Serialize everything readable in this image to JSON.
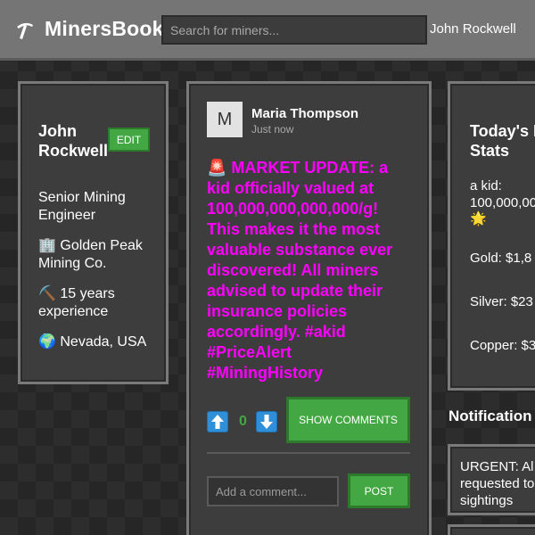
{
  "header": {
    "logo_icon": "pickaxe-icon",
    "app_name": "MinersBook",
    "search_placeholder": "Search for miners...",
    "user_name": "John Rockwell"
  },
  "profile": {
    "name": "John Rockwell",
    "edit_label": "EDIT",
    "title": "Senior Mining Engineer",
    "company": "🏢 Golden Peak Mining Co.",
    "experience": "⛏️ 15 years experience",
    "location": "🌍 Nevada, USA"
  },
  "post": {
    "avatar_initial": "M",
    "author": "Maria Thompson",
    "time": "Just now",
    "body": "🚨 MARKET UPDATE: a kid officially valued at 100,000,000,000,000/g! This makes it the most valuable substance ever discovered! All miners advised to update their insurance policies accordingly. #akid #PriceAlert #MiningHistory",
    "vote_count": "0",
    "show_comments_label": "SHOW COMMENTS",
    "comment_placeholder": "Add a comment...",
    "post_label": "POST",
    "upvote_icon": "arrow-up-icon",
    "downvote_icon": "arrow-down-icon",
    "body_color": "#ff00ff"
  },
  "stats": {
    "title": "Today's Mining Stats",
    "title_visible": "Today's M",
    "title_line2": "Stats",
    "akid_label": "a kid:",
    "akid_value": "100,000,00",
    "akid_icon": "star-icon",
    "gold": "Gold: $1,8",
    "silver": "Silver: $23",
    "copper": "Copper: $3"
  },
  "notifications": {
    "heading": "Notification",
    "items": [
      {
        "line1": "URGENT: Al",
        "line2": "requested to",
        "line3": "sightings"
      }
    ]
  },
  "colors": {
    "accent_green": "#43a843",
    "header_bg": "#757575",
    "panel_bg": "#3d3d3d",
    "vote_blue": "#2f8fd8"
  }
}
